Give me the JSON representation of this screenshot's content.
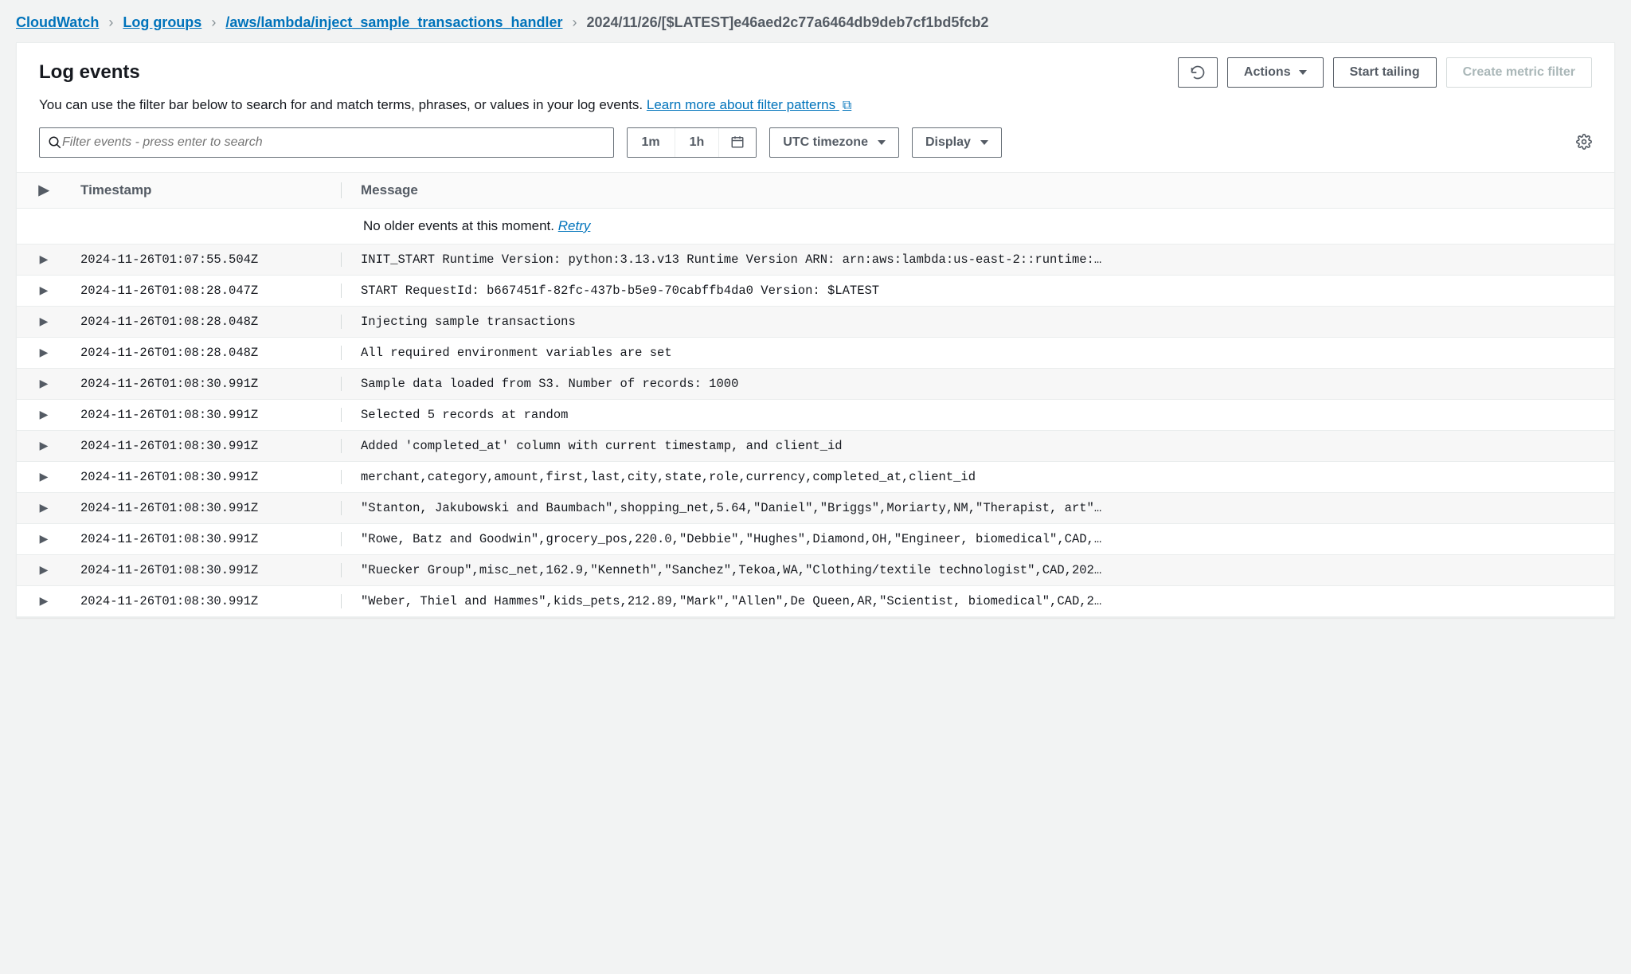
{
  "breadcrumb": {
    "items": [
      {
        "label": "CloudWatch",
        "link": true
      },
      {
        "label": "Log groups",
        "link": true
      },
      {
        "label": "/aws/lambda/inject_sample_transactions_handler",
        "link": true
      },
      {
        "label": "2024/11/26/[$LATEST]e46aed2c77a6464db9deb7cf1bd5fcb2",
        "link": false
      }
    ]
  },
  "header": {
    "title": "Log events",
    "actions_label": "Actions",
    "start_tailing_label": "Start tailing",
    "create_metric_label": "Create metric filter"
  },
  "subtext": {
    "text": "You can use the filter bar below to search for and match terms, phrases, or values in your log events. ",
    "link_label": "Learn more about filter patterns"
  },
  "filter": {
    "placeholder": "Filter events - press enter to search",
    "time_1m": "1m",
    "time_1h": "1h",
    "timezone_label": "UTC timezone",
    "display_label": "Display"
  },
  "table": {
    "col_timestamp": "Timestamp",
    "col_message": "Message",
    "no_older_text": "No older events at this moment. ",
    "retry_label": "Retry",
    "rows": [
      {
        "ts": "2024-11-26T01:07:55.504Z",
        "msg": "INIT_START Runtime Version: python:3.13.v13 Runtime Version ARN: arn:aws:lambda:us-east-2::runtime:…"
      },
      {
        "ts": "2024-11-26T01:08:28.047Z",
        "msg": "START RequestId: b667451f-82fc-437b-b5e9-70cabffb4da0 Version: $LATEST"
      },
      {
        "ts": "2024-11-26T01:08:28.048Z",
        "msg": "Injecting sample transactions"
      },
      {
        "ts": "2024-11-26T01:08:28.048Z",
        "msg": "All required environment variables are set"
      },
      {
        "ts": "2024-11-26T01:08:30.991Z",
        "msg": "Sample data loaded from S3. Number of records: 1000"
      },
      {
        "ts": "2024-11-26T01:08:30.991Z",
        "msg": "Selected 5 records at random"
      },
      {
        "ts": "2024-11-26T01:08:30.991Z",
        "msg": "Added 'completed_at' column with current timestamp, and client_id"
      },
      {
        "ts": "2024-11-26T01:08:30.991Z",
        "msg": "merchant,category,amount,first,last,city,state,role,currency,completed_at,client_id"
      },
      {
        "ts": "2024-11-26T01:08:30.991Z",
        "msg": "\"Stanton, Jakubowski and Baumbach\",shopping_net,5.64,\"Daniel\",\"Briggs\",Moriarty,NM,\"Therapist, art\"…"
      },
      {
        "ts": "2024-11-26T01:08:30.991Z",
        "msg": "\"Rowe, Batz and Goodwin\",grocery_pos,220.0,\"Debbie\",\"Hughes\",Diamond,OH,\"Engineer, biomedical\",CAD,…"
      },
      {
        "ts": "2024-11-26T01:08:30.991Z",
        "msg": "\"Ruecker Group\",misc_net,162.9,\"Kenneth\",\"Sanchez\",Tekoa,WA,\"Clothing/textile technologist\",CAD,202…"
      },
      {
        "ts": "2024-11-26T01:08:30.991Z",
        "msg": "\"Weber, Thiel and Hammes\",kids_pets,212.89,\"Mark\",\"Allen\",De Queen,AR,\"Scientist, biomedical\",CAD,2…"
      }
    ]
  }
}
